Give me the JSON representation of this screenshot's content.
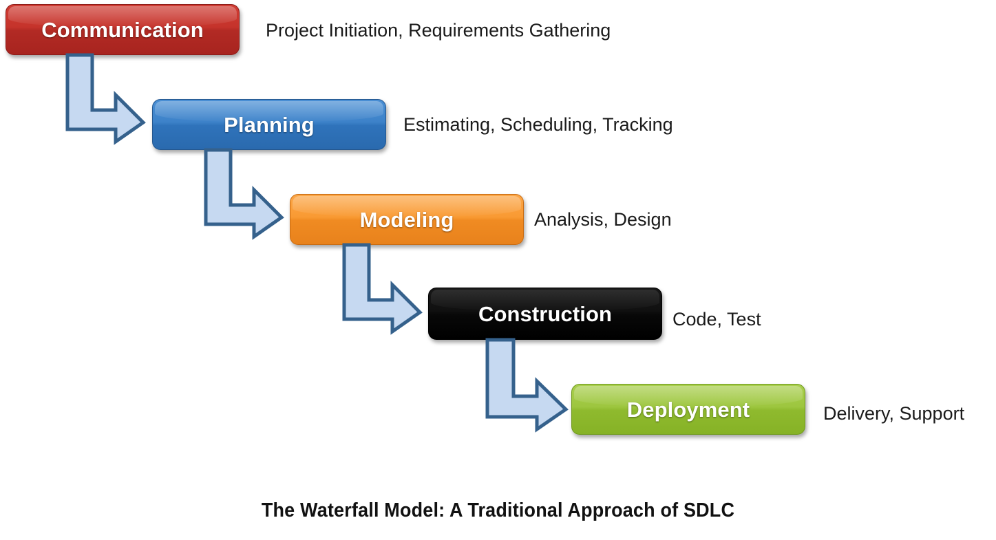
{
  "diagram": {
    "caption": "The Waterfall Model: A Traditional Approach of SDLC",
    "phases": [
      {
        "id": "communication",
        "label": "Communication",
        "annotation": "Project Initiation, Requirements Gathering",
        "color": "#c5332b",
        "text_color": "#ffffff"
      },
      {
        "id": "planning",
        "label": "Planning",
        "annotation": "Estimating, Scheduling, Tracking",
        "color": "#3d82c9",
        "text_color": "#ffffff"
      },
      {
        "id": "modeling",
        "label": "Modeling",
        "annotation": "Analysis, Design",
        "color": "#f99a33",
        "text_color": "#ffffff"
      },
      {
        "id": "construction",
        "label": "Construction",
        "annotation": "Code, Test",
        "color": "#000000",
        "text_color": "#ffffff"
      },
      {
        "id": "deployment",
        "label": "Deployment",
        "annotation": "Delivery, Support",
        "color": "#9dc63f",
        "text_color": "#ffffff"
      }
    ],
    "connectors": [
      {
        "id": "communication-to-planning",
        "from": "communication",
        "to": "planning",
        "shape": "elbow-down-right-arrow"
      },
      {
        "id": "planning-to-modeling",
        "from": "planning",
        "to": "modeling",
        "shape": "elbow-down-right-arrow"
      },
      {
        "id": "modeling-to-construction",
        "from": "modeling",
        "to": "construction",
        "shape": "elbow-down-right-arrow"
      },
      {
        "id": "construction-to-deployment",
        "from": "construction",
        "to": "deployment",
        "shape": "elbow-down-right-arrow"
      }
    ],
    "arrow_fill": "#c6d9f1",
    "arrow_stroke": "#35618c",
    "background": "#ffffff"
  }
}
